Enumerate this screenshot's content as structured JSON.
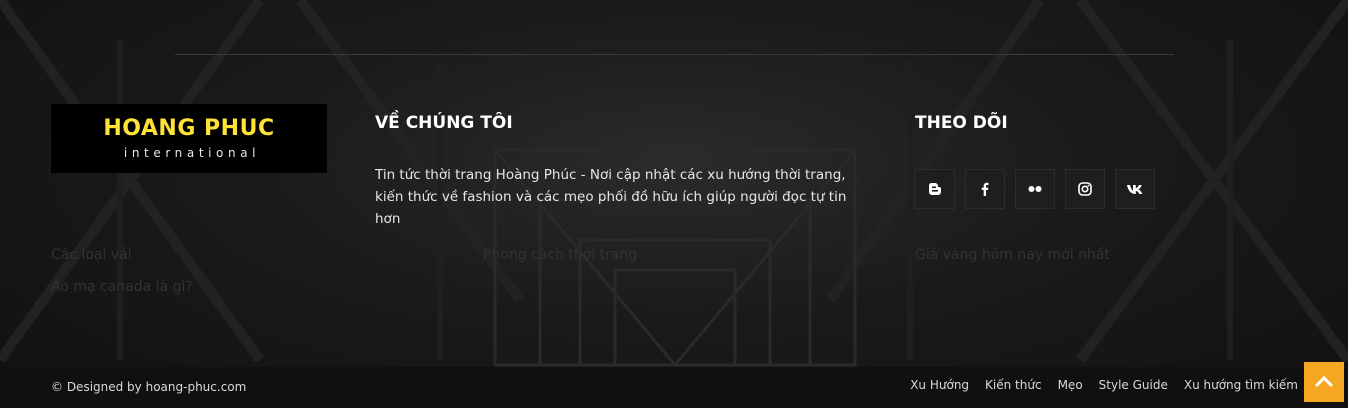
{
  "logo": {
    "main": "HOANG PHUC",
    "sub": "international"
  },
  "about": {
    "heading": "VỀ CHÚNG TÔI",
    "text": "Tin tức thời trang Hoàng Phúc - Nơi cập nhật các xu hướng thời trang, kiến thức về fashion và các mẹo phối đồ hữu ích giúp người đọc tự tin hơn"
  },
  "follow": {
    "heading": "THEO DÕI",
    "icons": [
      "blogger-icon",
      "facebook-icon",
      "flickr-icon",
      "instagram-icon",
      "vk-icon"
    ]
  },
  "taglines": [
    "Các loại vải",
    "Áo mạ canada là gì?",
    "Phong cách thời trang",
    "Giá vàng hôm nay mới nhất"
  ],
  "bottom": {
    "copyright": "© Designed by hoang-phuc.com",
    "menu": [
      "Xu Hướng",
      "Kiến thức",
      "Mẹo",
      "Style Guide",
      "Xu hướng tìm kiếm"
    ]
  },
  "colors": {
    "accent": "#f5a623",
    "logo_yellow": "#ffe236"
  }
}
